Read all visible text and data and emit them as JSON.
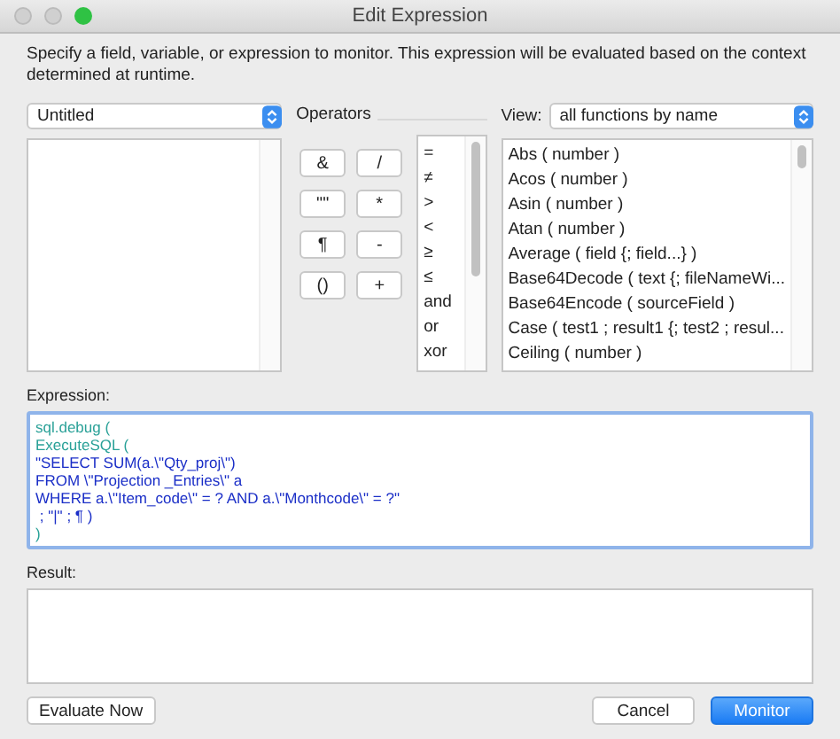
{
  "window": {
    "title": "Edit Expression"
  },
  "description": "Specify a field, variable, or expression to monitor. This expression will be evaluated based on the context determined at runtime.",
  "table_select": {
    "value": "Untitled"
  },
  "operators": {
    "label": "Operators",
    "buttons": [
      "&",
      "/",
      "\"\"",
      "*",
      "¶",
      "-",
      "()",
      "+"
    ],
    "list": [
      "=",
      "≠",
      ">",
      "<",
      "≥",
      "≤",
      "and",
      "or",
      "xor"
    ]
  },
  "view": {
    "label": "View:",
    "value": "all functions by name"
  },
  "functions": [
    "Abs ( number )",
    "Acos ( number )",
    "Asin ( number )",
    "Atan ( number )",
    "Average ( field {; field...} )",
    "Base64Decode ( text {; fileNameWi...",
    "Base64Encode ( sourceField )",
    "Case ( test1 ; result1 {; test2 ; resul...",
    "Ceiling ( number )"
  ],
  "expression": {
    "label": "Expression:",
    "lines": [
      {
        "text": "sql.debug (",
        "kind": "function"
      },
      {
        "text": "ExecuteSQL (",
        "kind": "function"
      },
      {
        "text": "\"SELECT SUM(a.\\\"Qty_proj\\\")",
        "kind": "string"
      },
      {
        "text": "FROM \\\"Projection _Entries\\\" a",
        "kind": "string"
      },
      {
        "text": "WHERE a.\\\"Item_code\\\" = ? AND a.\\\"Monthcode\\\" = ?\"",
        "kind": "string"
      },
      {
        "text": " ; \"|\" ; ¶ )",
        "kind": "string"
      },
      {
        "text": ")",
        "kind": "function"
      }
    ]
  },
  "result": {
    "label": "Result:"
  },
  "buttons": {
    "evaluate": "Evaluate Now",
    "cancel": "Cancel",
    "monitor": "Monitor"
  }
}
